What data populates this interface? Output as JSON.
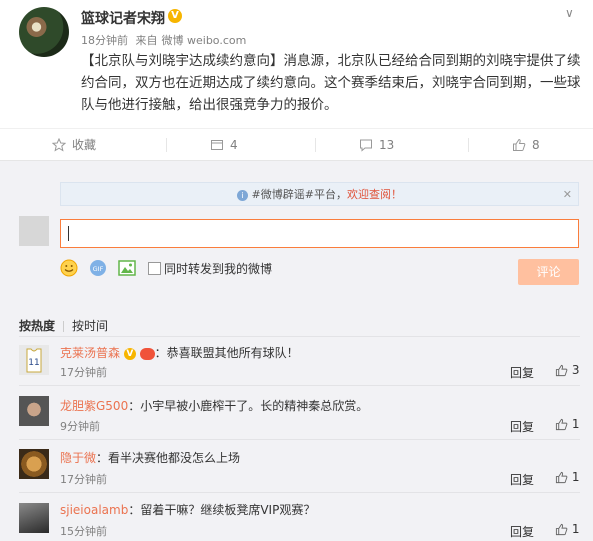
{
  "post": {
    "author": "篮球记者宋翔",
    "verified_badge": "V",
    "time": "18分钟前",
    "source_prefix": "来自",
    "source": "微博 weibo.com",
    "text": "【北京队与刘晓宇达成续约意向】消息源，北京队已经给合同到期的刘晓宇提供了续约合同，双方也在近期达成了续约意向。这个赛季结束后，刘晓宇合同到期，一些球队与他进行接触，给出很强竞争力的报价。"
  },
  "actions": {
    "favorite": "收藏",
    "repost": "4",
    "comment": "13",
    "like": "8"
  },
  "notice": {
    "prefix": "#微博辟谣#平台，",
    "highlight": "欢迎查阅！"
  },
  "composer": {
    "value": "",
    "sync_label": "同时转发到我的微博",
    "submit": "评论"
  },
  "sort": {
    "hot": "按热度",
    "time": "按时间"
  },
  "comments": [
    {
      "name": "克莱汤普森",
      "text": "：恭喜联盟其他所有球队！",
      "time": "17分钟前",
      "reply": "回复",
      "likes": "3"
    },
    {
      "name": "龙胆紫G500",
      "text": "：小宇早被小鹿榨干了。长的精神秦总欣赏。",
      "time": "9分钟前",
      "reply": "回复",
      "likes": "1"
    },
    {
      "name": "隐于微",
      "text": "：看半决赛他都没怎么上场",
      "time": "17分钟前",
      "reply": "回复",
      "likes": "1"
    },
    {
      "name": "sjieioalamb",
      "text": "：留着干嘛？继续板凳席VIP观赛？",
      "time": "15分钟前",
      "reply": "回复",
      "likes": "1"
    }
  ],
  "colors": {
    "accent_orange": "#fa7d3c",
    "link_orange": "#eb7350",
    "verified_gold": "#f7b500",
    "submit_disabled": "#ffc09f"
  }
}
